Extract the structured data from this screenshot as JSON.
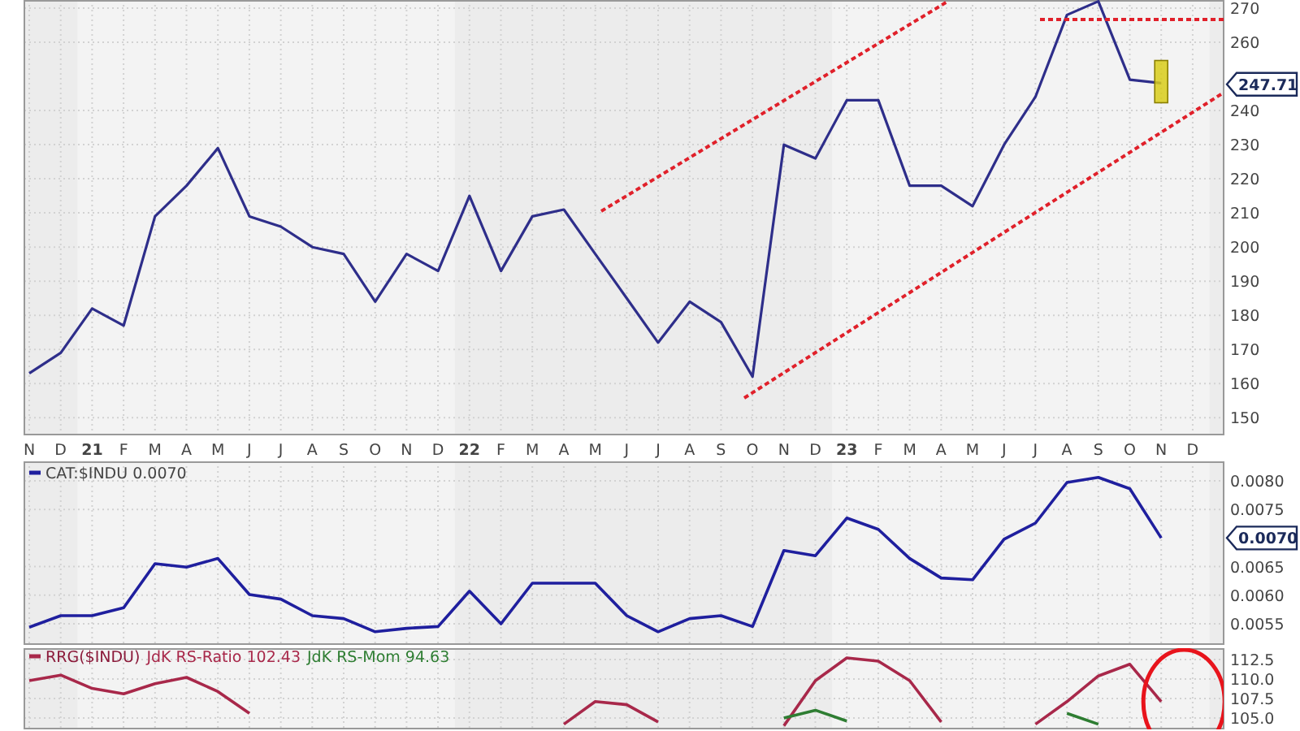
{
  "price_panel": {
    "last_label": "247.71",
    "chart_data": {
      "type": "line",
      "grid": true,
      "categories": [
        "N",
        "D",
        "21",
        "F",
        "M",
        "A",
        "M",
        "J",
        "J",
        "A",
        "S",
        "O",
        "N",
        "D",
        "22",
        "F",
        "M",
        "A",
        "M",
        "J",
        "J",
        "A",
        "S",
        "O",
        "N",
        "D",
        "23",
        "F",
        "M",
        "A",
        "M",
        "J",
        "J",
        "A",
        "S",
        "O",
        "N",
        "D"
      ],
      "series": [
        {
          "color": "#2e2e8a",
          "values": [
            163,
            169,
            182,
            177,
            209,
            218,
            229,
            209,
            206,
            200,
            198,
            184,
            198,
            193,
            215,
            193,
            209,
            211,
            198,
            185,
            172,
            184,
            178,
            162,
            230,
            226,
            243,
            243,
            218,
            218,
            212,
            230,
            244,
            268,
            272,
            249,
            248,
            null
          ]
        }
      ],
      "ylim": [
        144.8,
        272.4
      ],
      "yticks": [
        150,
        160,
        170,
        180,
        190,
        200,
        210,
        220,
        230,
        240,
        260,
        270
      ]
    },
    "trend_lines": {
      "kind": "channel"
    }
  },
  "ratio_panel": {
    "last_label": "0.0070",
    "legend_value": "0.0070",
    "chart_data": {
      "type": "line",
      "grid": true,
      "series": [
        {
          "name": "CAT:$INDU",
          "color": "#1f1f9e",
          "values": [
            0.00544,
            0.00564,
            0.00564,
            0.00578,
            0.00655,
            0.00649,
            0.00664,
            0.00601,
            0.00593,
            0.00564,
            0.00559,
            0.00536,
            0.00542,
            0.00545,
            0.00607,
            0.0055,
            0.00621,
            0.00621,
            0.00621,
            0.00564,
            0.00536,
            0.00559,
            0.00564,
            0.00545,
            0.00678,
            0.00669,
            0.00735,
            0.00715,
            0.00664,
            0.0063,
            0.00627,
            0.00698,
            0.00726,
            0.00797,
            0.00806,
            0.00786,
            0.007,
            null
          ]
        }
      ],
      "ylim": [
        0.00513,
        0.00834
      ],
      "yticks": [
        {
          "value": 0.008,
          "label": "0.0080"
        },
        {
          "value": 0.0075,
          "label": "0.0075"
        },
        {
          "value": 0.0065,
          "label": "0.0065"
        },
        {
          "value": 0.006,
          "label": "0.0060"
        },
        {
          "value": 0.0055,
          "label": "0.0055"
        }
      ]
    }
  },
  "rrg_panel": {
    "legend_title": "RRG($INDU)",
    "legend_values": [
      "102.43",
      "94.63"
    ],
    "highlight": {
      "kind": "ellipse"
    },
    "chart_data": {
      "type": "line",
      "grid": true,
      "series": [
        {
          "name": "JdK RS-Ratio",
          "color": "#a8284a",
          "values": [
            109.8,
            110.5,
            108.8,
            108.1,
            109.4,
            110.2,
            108.4,
            105.6,
            null,
            null,
            null,
            null,
            null,
            null,
            null,
            null,
            null,
            104.2,
            107.1,
            106.7,
            104.5,
            null,
            null,
            null,
            104.0,
            109.8,
            112.7,
            112.3,
            109.8,
            104.5,
            null,
            null,
            104.2,
            107.1,
            110.4,
            111.9,
            107.1,
            null
          ]
        },
        {
          "name": "JdK RS-Mom",
          "color": "#2e7d32",
          "values": [
            null,
            null,
            null,
            null,
            null,
            null,
            null,
            null,
            null,
            null,
            null,
            null,
            null,
            null,
            null,
            null,
            null,
            null,
            null,
            null,
            null,
            null,
            null,
            null,
            105.0,
            106.0,
            104.6,
            null,
            null,
            null,
            null,
            null,
            null,
            105.6,
            104.2,
            null,
            null,
            null
          ]
        }
      ],
      "ylim": [
        103.54,
        113.96
      ],
      "yticks": [
        {
          "value": 112.5,
          "label": "112.5"
        },
        {
          "value": 110,
          "label": "110.0"
        },
        {
          "value": 107.5,
          "label": "107.5"
        },
        {
          "value": 105,
          "label": "105.0"
        }
      ]
    }
  }
}
